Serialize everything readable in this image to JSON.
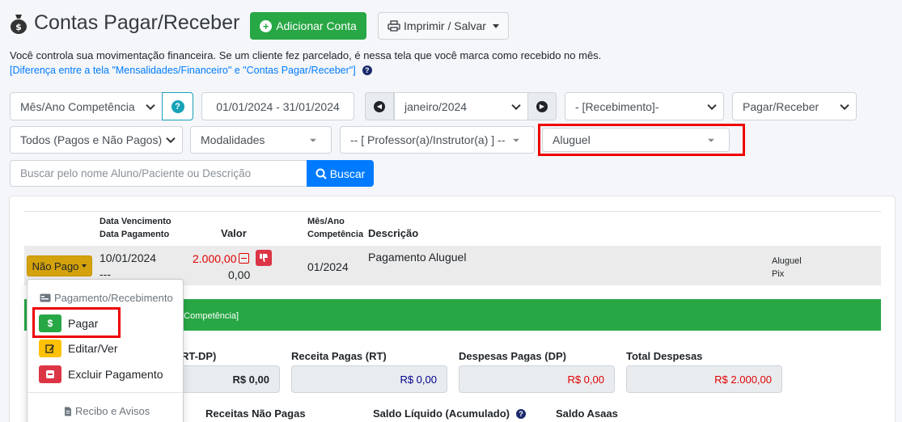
{
  "header": {
    "title": "Contas Pagar/Receber",
    "add_label": "Adicionar Conta",
    "print_label": "Imprimir / Salvar"
  },
  "description": "Você controla sua movimentação financeira. Se um cliente fez parcelado, é nessa tela que você marca como recebido no mês.",
  "help_link": "[Diferença entre a tela \"Mensalidades/Financeiro\" e \"Contas Pagar/Receber\"]",
  "filters": {
    "competencia": "Mês/Ano Competência",
    "date_range": "01/01/2024 - 31/01/2024",
    "month": "janeiro/2024",
    "recebimento": "- [Recebimento]-",
    "pagar_receber": "Pagar/Receber",
    "pagos": "Todos (Pagos e Não Pagos)",
    "modalidades": "Modalidades",
    "professor": "-- [ Professor(a)/Instrutor(a) ] --",
    "categoria": "Aluguel",
    "search_placeholder": "Buscar pelo nome Aluno/Paciente ou Descrição",
    "search_button": "Buscar"
  },
  "table": {
    "col_venc_1": "Data Vencimento",
    "col_venc_2": "Data Pagamento",
    "col_valor": "Valor",
    "col_comp_1": "Mês/Ano",
    "col_comp_2": "Competência",
    "col_desc": "Descrição",
    "rows": [
      {
        "status": "Não Pago",
        "vencimento": "10/01/2024",
        "pagamento": "---",
        "valor": "2.000,00",
        "valor_pago": "0,00",
        "competencia": "01/2024",
        "descricao": "Pagamento Aluguel",
        "categoria": "Aluguel",
        "forma": "Pix"
      }
    ]
  },
  "summary": {
    "bar_text": "o Competência]",
    "rt_dp_label": "RT-DP)",
    "rt_dp_value": "R$ 0,00",
    "receita_label": "Receita Pagas (RT)",
    "receita_value": "R$ 0,00",
    "despesa_label": "Despesas Pagas (DP)",
    "despesa_value": "R$ 0,00",
    "total_label": "Total Despesas",
    "total_value": "R$ 2.000,00",
    "receitas_np": "Receitas Não Pagas",
    "saldo_liq": "Saldo Líquido (Acumulado)",
    "saldo_asaas": "Saldo Asaas"
  },
  "menu": {
    "header": "Pagamento/Recebimento",
    "pagar": "Pagar",
    "editar": "Editar/Ver",
    "excluir": "Excluir Pagamento",
    "recibo": "Recibo e Avisos"
  },
  "colors": {
    "green": "#28a745",
    "blue": "#007bff",
    "red": "#e00000",
    "warning": "#d4a20c"
  }
}
